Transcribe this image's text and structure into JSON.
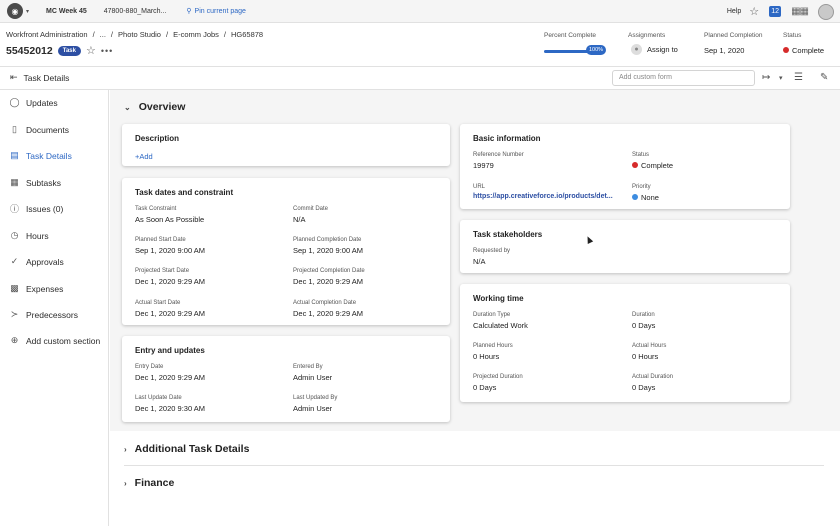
{
  "topbar": {
    "tabs": [
      "MC Week 45",
      "47800-880_March..."
    ],
    "pin_label": "Pin current page",
    "help_label": "Help",
    "notifications": "12"
  },
  "header": {
    "breadcrumb": [
      "Workfront Administration",
      "/",
      "...",
      "/",
      "Photo Studio",
      "/",
      "E-comm Jobs",
      "/",
      "HG65878"
    ],
    "title": "55452012",
    "badge": "Task",
    "percent_label": "Percent Complete",
    "percent_value": "100%",
    "percent_fraction": 1.0,
    "assignments_label": "Assignments",
    "assignments_value": "Assign to",
    "planned_label": "Planned Completion",
    "planned_value": "Sep 1, 2020",
    "status_label": "Status",
    "status_value": "Complete",
    "status_color": "#d62b2b"
  },
  "toolbar": {
    "title": "Task Details",
    "custom_form_placeholder": "Add custom form"
  },
  "sidebar": {
    "items": [
      {
        "label": "Updates",
        "icon": "chat-icon"
      },
      {
        "label": "Documents",
        "icon": "document-icon"
      },
      {
        "label": "Task Details",
        "icon": "details-icon"
      },
      {
        "label": "Subtasks",
        "icon": "subtasks-icon"
      },
      {
        "label": "Issues (0)",
        "icon": "issues-icon"
      },
      {
        "label": "Hours",
        "icon": "clock-icon"
      },
      {
        "label": "Approvals",
        "icon": "check-circle-icon"
      },
      {
        "label": "Expenses",
        "icon": "money-icon"
      },
      {
        "label": "Predecessors",
        "icon": "predecessors-icon"
      },
      {
        "label": "Add custom section",
        "icon": "plus-circle-icon"
      }
    ]
  },
  "overview": {
    "title": "Overview",
    "description": {
      "title": "Description",
      "add": "+Add"
    },
    "dates": {
      "title": "Task dates and constraint",
      "fields": [
        {
          "label": "Task Constraint",
          "value": "As Soon As Possible"
        },
        {
          "label": "Commit Date",
          "value": "N/A"
        },
        {
          "label": "Planned Start Date",
          "value": "Sep 1, 2020 9:00 AM"
        },
        {
          "label": "Planned Completion Date",
          "value": "Sep 1, 2020 9:00 AM"
        },
        {
          "label": "Projected Start Date",
          "value": "Dec 1, 2020 9:29 AM"
        },
        {
          "label": "Projected Completion Date",
          "value": "Dec 1, 2020 9:29 AM"
        },
        {
          "label": "Actual Start Date",
          "value": "Dec 1, 2020 9:29 AM"
        },
        {
          "label": "Actual Completion Date",
          "value": "Dec 1, 2020 9:29 AM"
        }
      ]
    },
    "entry": {
      "title": "Entry and updates",
      "fields": [
        {
          "label": "Entry Date",
          "value": "Dec 1, 2020 9:29 AM"
        },
        {
          "label": "Entered By",
          "value": "Admin User"
        },
        {
          "label": "Last Update Date",
          "value": "Dec 1, 2020 9:30 AM"
        },
        {
          "label": "Last Updated By",
          "value": "Admin User"
        }
      ]
    },
    "basic": {
      "title": "Basic information",
      "fields": [
        {
          "label": "Reference Number",
          "value": "19979"
        },
        {
          "label": "Status",
          "value": "Complete"
        },
        {
          "label": "URL",
          "value": "https://app.creativeforce.io/products/det..."
        },
        {
          "label": "Priority",
          "value": "None"
        }
      ]
    },
    "stakeholders": {
      "title": "Task stakeholders",
      "fields": [
        {
          "label": "Requested by",
          "value": "N/A"
        }
      ]
    },
    "working": {
      "title": "Working time",
      "fields": [
        {
          "label": "Duration Type",
          "value": "Calculated Work"
        },
        {
          "label": "Duration",
          "value": "0 Days"
        },
        {
          "label": "Planned Hours",
          "value": "0 Hours"
        },
        {
          "label": "Actual Hours",
          "value": "0 Hours"
        },
        {
          "label": "Projected Duration",
          "value": "0 Days"
        },
        {
          "label": "Actual Duration",
          "value": "0 Days"
        }
      ]
    }
  },
  "sections": {
    "additional": "Additional Task Details",
    "finance": "Finance"
  }
}
